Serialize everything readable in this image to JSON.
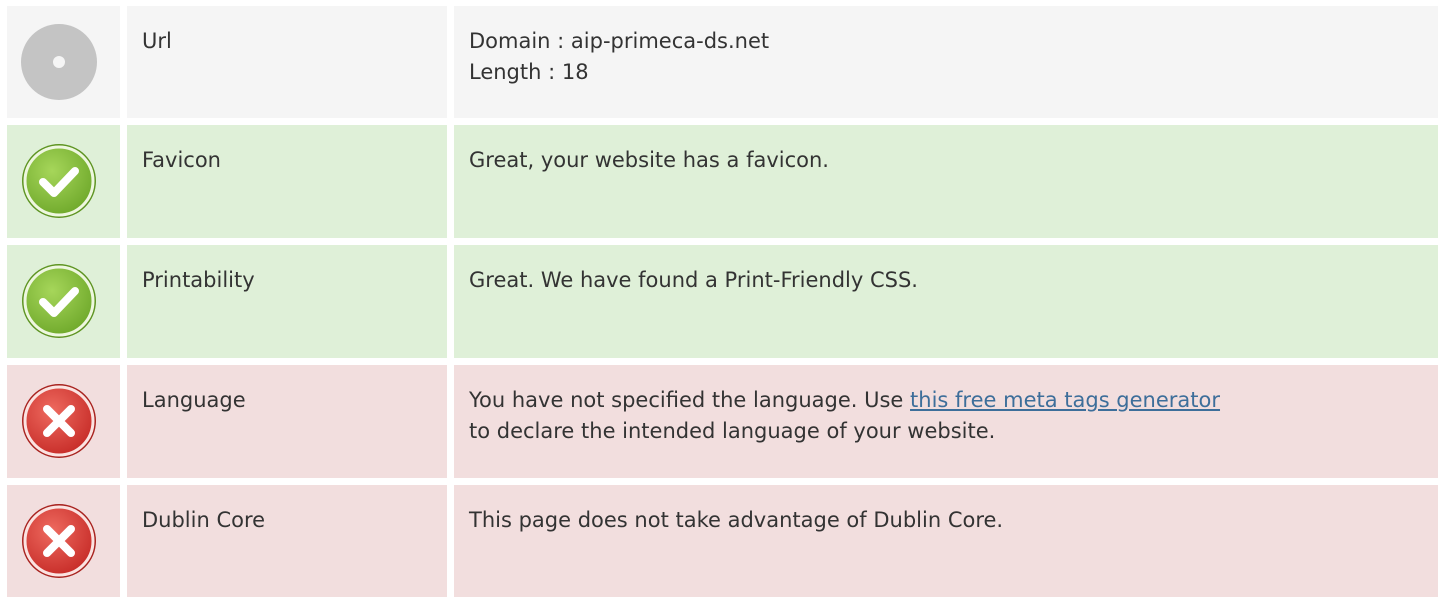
{
  "rows": [
    {
      "status": "neutral",
      "icon": "neutral-dot-icon",
      "label": "Url",
      "lines": [
        "Domain : aip-primeca-ds.net",
        "Length : 18"
      ]
    },
    {
      "status": "pass",
      "icon": "check-icon",
      "label": "Favicon",
      "text": "Great, your website has a favicon."
    },
    {
      "status": "pass",
      "icon": "check-icon",
      "label": "Printability",
      "text": "Great. We have found a Print-Friendly CSS."
    },
    {
      "status": "fail",
      "icon": "cross-icon",
      "label": "Language",
      "text_before": "You have not specified the language. Use ",
      "link_text": "this free meta tags generator",
      "text_after": "to declare the intended language of your website."
    },
    {
      "status": "fail",
      "icon": "cross-icon",
      "label": "Dublin Core",
      "text": "This page does not take advantage of Dublin Core."
    }
  ],
  "colors": {
    "neutral_bg": "#f5f5f5",
    "pass_bg": "#dff0d8",
    "fail_bg": "#f2dede",
    "link": "#3d6e9a",
    "pass_icon": "#8cc43f",
    "fail_icon": "#d93a36",
    "neutral_icon": "#c4c4c4"
  }
}
